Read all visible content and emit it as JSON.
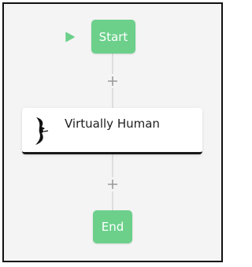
{
  "workflow": {
    "start_label": "Start",
    "end_label": "End",
    "step": {
      "title": "Virtually Human",
      "logo_icon": "virtually-human-logo-icon"
    },
    "icons": {
      "play": "play-icon",
      "add": "plus-icon"
    },
    "colors": {
      "node_green": "#6cd08b",
      "canvas": "#f4f4f4",
      "connector": "#dedede",
      "card_border": "#1a1a1a"
    }
  }
}
